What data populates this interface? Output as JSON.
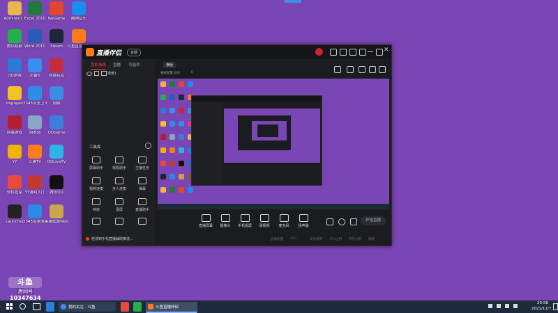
{
  "colors": {
    "desktop": "#7a45b4",
    "window": "#1b1c20",
    "accent": "#ff3b2f",
    "taskbar": "#1d2a3a"
  },
  "desktop_icons": [
    {
      "label": "Administr...",
      "icon": "folder-icon",
      "color": "#e8b64c"
    },
    {
      "label": "Excel 2010",
      "icon": "excel-icon",
      "color": "#1f7a3c"
    },
    {
      "label": "WeGame",
      "icon": "wegame-icon",
      "color": "#e2472c"
    },
    {
      "label": "酷狗音乐",
      "icon": "kugou-icon",
      "color": "#1a8df0"
    },
    {
      "label": "腾讯视频",
      "icon": "tencent-video-icon",
      "color": "#25b04e"
    },
    {
      "label": "Word 2010",
      "icon": "word-icon",
      "color": "#2a5bb5"
    },
    {
      "label": "Steam",
      "icon": "steam-icon",
      "color": "#1b2838"
    },
    {
      "label": "斗鱼直播伴侣",
      "icon": "douyu-icon",
      "color": "#ff7a1a"
    },
    {
      "label": "QQ游戏",
      "icon": "qq-game-icon",
      "color": "#2e7bd6"
    },
    {
      "label": "迅雷X",
      "icon": "xunlei-icon",
      "color": "#3b8ef0"
    },
    {
      "label": "网易有道",
      "icon": "netease-icon",
      "color": "#c72a3c"
    },
    {
      "label": "此电脑",
      "icon": "computer-icon",
      "color": "#3a8de0"
    },
    {
      "label": "dnplayer",
      "icon": "dnplayer-icon",
      "color": "#f3c227"
    },
    {
      "label": "2345安全卫士",
      "icon": "security-icon",
      "color": "#2d8ee8"
    },
    {
      "label": "网络",
      "icon": "network-icon",
      "color": "#3a8de0"
    },
    {
      "label": "YoukuDes...",
      "icon": "youku-icon",
      "color": "#e13a8c"
    },
    {
      "label": "网易游戏",
      "icon": "netease-game-icon",
      "color": "#b21f2e"
    },
    {
      "label": "回收站",
      "icon": "recycle-bin-icon",
      "color": "#8aa6c4"
    },
    {
      "label": "QQGame",
      "icon": "qqgame-icon",
      "color": "#3d7fd9"
    },
    {
      "label": "腾讯游戏",
      "icon": "folder-icon",
      "color": "#e8b64c"
    },
    {
      "label": "YY",
      "icon": "yy-icon",
      "color": "#f0b400"
    },
    {
      "label": "芒果TV",
      "icon": "mango-icon",
      "color": "#ff7b1c"
    },
    {
      "label": "QQLiveTV",
      "icon": "qqlive-icon",
      "color": "#2db5e6"
    },
    {
      "label": "Internet Explorer",
      "icon": "ie-icon",
      "color": "#2a7fe0"
    },
    {
      "label": "软件管家",
      "icon": "software-icon",
      "color": "#e84a3b"
    },
    {
      "label": "YY游戏大厅",
      "icon": "yy-game-icon",
      "color": "#c23a2f"
    },
    {
      "label": "腾讯QQ",
      "icon": "qq-icon",
      "color": "#111111"
    },
    {
      "label": "Battle.net Launcher",
      "icon": "battlenet-icon",
      "color": "#1d6fd8"
    },
    {
      "label": "Launcher",
      "icon": "launcher-icon",
      "color": "#222222"
    },
    {
      "label": "2345加速浏览器",
      "icon": "browser-icon",
      "color": "#2a8ae8"
    },
    {
      "label": "英雄联盟WeGame",
      "icon": "lol-icon",
      "color": "#c9a64a"
    },
    {
      "label": "炉石传说",
      "icon": "hearthstone-icon",
      "color": "#8a5a2a"
    }
  ],
  "watermark": {
    "room_label": "房间号",
    "room_number": "10347634",
    "brand": "斗鱼"
  },
  "app": {
    "title": "直播伴侣",
    "version_badge": "直播",
    "tabs": [
      "我的场景",
      "直播",
      "可选项"
    ],
    "active_tab_index": 0,
    "scene_label": "场景1",
    "scene_tab": "横版",
    "preview_info": "横屏配置 640",
    "preview_count": "0",
    "tools_title": "工具库",
    "tools": [
      {
        "label": "屏幕助手",
        "icon": "screen-icon"
      },
      {
        "label": "观看助手",
        "icon": "viewer-icon"
      },
      {
        "label": "主播任务",
        "icon": "task-icon"
      },
      {
        "label": "视频连麦",
        "icon": "mic-icon"
      },
      {
        "label": "多人连麦",
        "icon": "group-icon"
      },
      {
        "label": "弹幕",
        "icon": "barrage-icon"
      },
      {
        "label": "特效",
        "icon": "fx-icon"
      },
      {
        "label": "录屏",
        "icon": "record-icon"
      },
      {
        "label": "直播助手",
        "icon": "helper-icon"
      },
      {
        "label": "",
        "icon": "more-icon"
      },
      {
        "label": "",
        "icon": "download-icon"
      },
      {
        "label": "",
        "icon": "gift-icon"
      }
    ],
    "notice": "检测到手机直播辅助推流...",
    "bottom_buttons": [
      {
        "label": "直播屏幕",
        "icon": "monitor-icon"
      },
      {
        "label": "摄像头",
        "icon": "camera-icon"
      },
      {
        "label": "手机投屏",
        "icon": "phone-icon"
      },
      {
        "label": "录视频",
        "icon": "video-icon"
      },
      {
        "label": "麦克风",
        "icon": "microphone-icon"
      },
      {
        "label": "扬声器",
        "icon": "speaker-icon"
      }
    ],
    "start_button": "开始直播",
    "status_items": [
      "直播质量",
      "CPU",
      "实时帧率",
      "CPU占用",
      "内存占用",
      "网络"
    ]
  },
  "taskbar": {
    "search_tip": "搜索",
    "tasks": [
      {
        "label": "我的关注 - 斗鱼",
        "icon": "browser-icon"
      },
      {
        "label": "斗鱼直播伴侣",
        "icon": "douyu-icon"
      }
    ],
    "time": "20:58",
    "date": "2021/11/7"
  }
}
